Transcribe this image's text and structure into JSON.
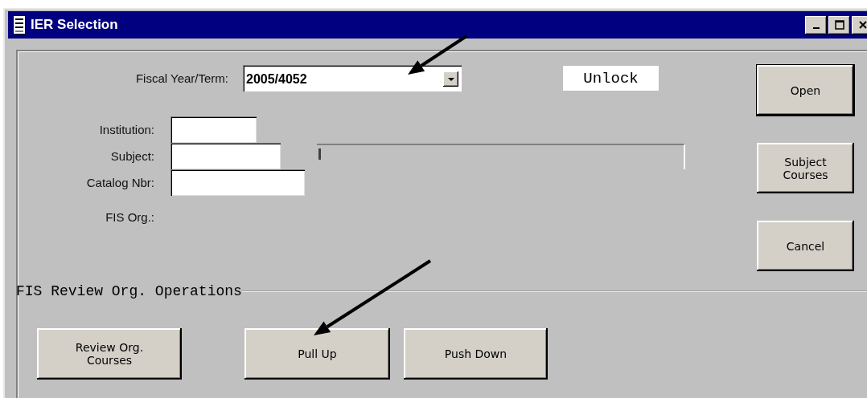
{
  "window": {
    "title": "IER Selection"
  },
  "form": {
    "fiscal_year_term": {
      "label": "Fiscal Year/Term:",
      "value": "2005/4052"
    },
    "unlock": "Unlock",
    "fields": [
      {
        "label": "Institution:"
      },
      {
        "label": "Subject:"
      },
      {
        "label": "Catalog Nbr:"
      }
    ],
    "fis_org_label": "FIS Org.:"
  },
  "side_buttons": [
    {
      "label": "Open",
      "default": true
    },
    {
      "label": "Subject Courses",
      "default": false
    },
    {
      "label": "Cancel",
      "default": false
    }
  ],
  "group": {
    "title": "FIS Review Org. Operations",
    "buttons": [
      "Review Org. Courses",
      "Pull Up",
      "Push Down"
    ]
  }
}
